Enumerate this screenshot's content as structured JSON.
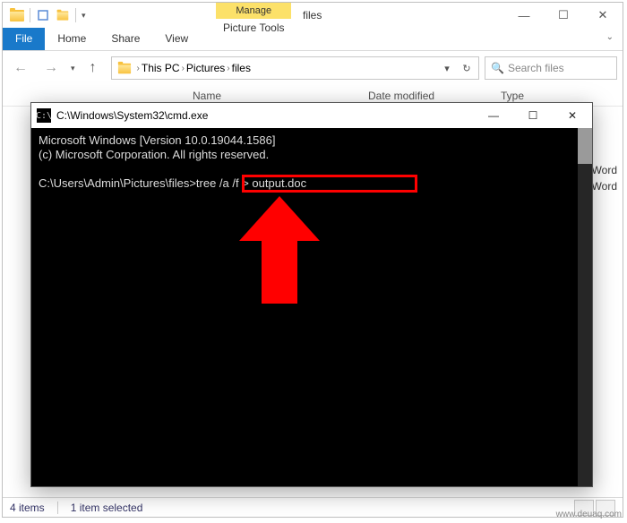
{
  "explorer": {
    "title": "files",
    "context_tab_label": "Manage",
    "context_group_label": "Picture Tools",
    "ribbon": {
      "file": "File",
      "home": "Home",
      "share": "Share",
      "view": "View"
    },
    "nav": {
      "back": "←",
      "forward": "→",
      "up": "↑"
    },
    "address": {
      "root": "This PC",
      "seg1": "Pictures",
      "seg2": "files"
    },
    "search_placeholder": "Search files",
    "columns": {
      "name": "Name",
      "date": "Date modified",
      "type": "Type"
    },
    "peek": {
      "row1": "Word",
      "row2": "Word"
    },
    "status": {
      "count": "4 items",
      "selected": "1 item selected"
    }
  },
  "cmd": {
    "title": "C:\\Windows\\System32\\cmd.exe",
    "line1": "Microsoft Windows [Version 10.0.19044.1586]",
    "line2": "(c) Microsoft Corporation. All rights reserved.",
    "prompt": "C:\\Users\\Admin\\Pictures\\files>",
    "command": "tree /a /f > output.doc"
  },
  "watermark": "www.deuaq.com"
}
